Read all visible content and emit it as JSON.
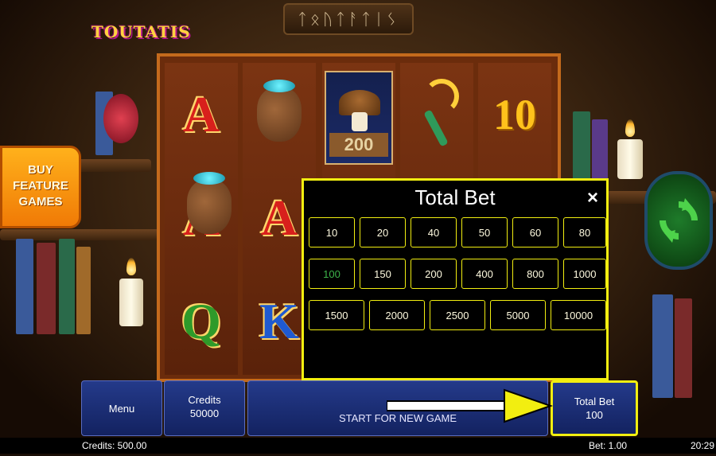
{
  "game": {
    "logo": "TOUTATIS",
    "runes": "ᛏᛟᚢᛏᚨᛏᛁᛊ"
  },
  "buy_feature": {
    "label": "BUY\nFEATURE\nGAMES"
  },
  "reels": [
    [
      "A",
      "Q",
      "A"
    ],
    [
      "bag",
      "bag",
      "K"
    ],
    [
      "mushroom",
      "",
      ""
    ],
    [
      "sickle",
      "",
      ""
    ],
    [
      "10",
      "",
      ""
    ]
  ],
  "mushroom_value": "200",
  "total_bet_panel": {
    "title": "Total Bet",
    "close": "×",
    "row1": [
      "10",
      "20",
      "40",
      "50",
      "60",
      "80"
    ],
    "row2": [
      "100",
      "150",
      "200",
      "400",
      "800",
      "1000"
    ],
    "row3": [
      "1500",
      "2000",
      "2500",
      "5000",
      "10000"
    ],
    "selected": "100"
  },
  "bottom": {
    "menu": "Menu",
    "credits_label": "Credits",
    "credits_value": "50000",
    "start": "START FOR NEW GAME",
    "total_bet_label": "Total Bet",
    "total_bet_value": "100"
  },
  "status": {
    "credits": "Credits: 500.00",
    "bet": "Bet: 1.00",
    "time": "20:29"
  },
  "colors": {
    "highlight": "#f2ee10",
    "selected": "#3db34a",
    "panel_blue": "#1b2e78"
  }
}
